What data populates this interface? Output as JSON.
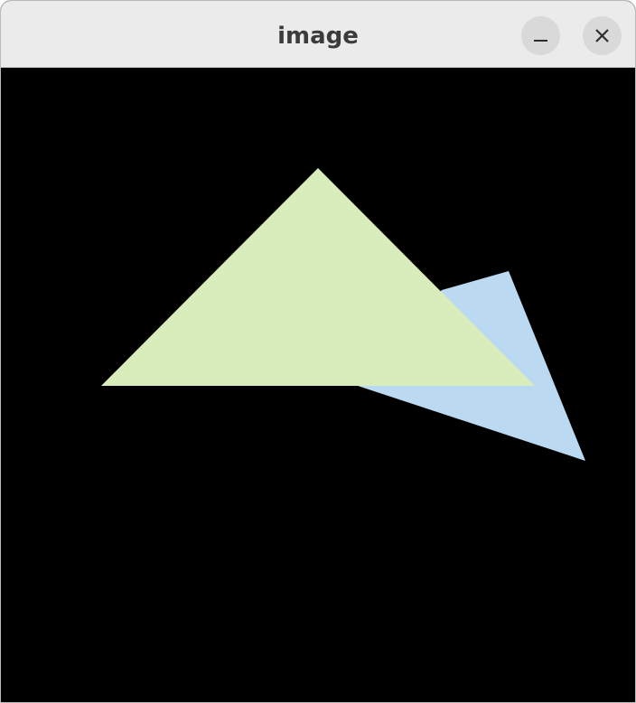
{
  "window": {
    "title": "image"
  },
  "controls": {
    "minimize_icon": "minimize-icon",
    "close_icon": "close-icon"
  },
  "colors": {
    "canvas_background": "#000000",
    "green_triangle": "#d9ecbc",
    "blue_triangle": "#bbdaf1"
  }
}
